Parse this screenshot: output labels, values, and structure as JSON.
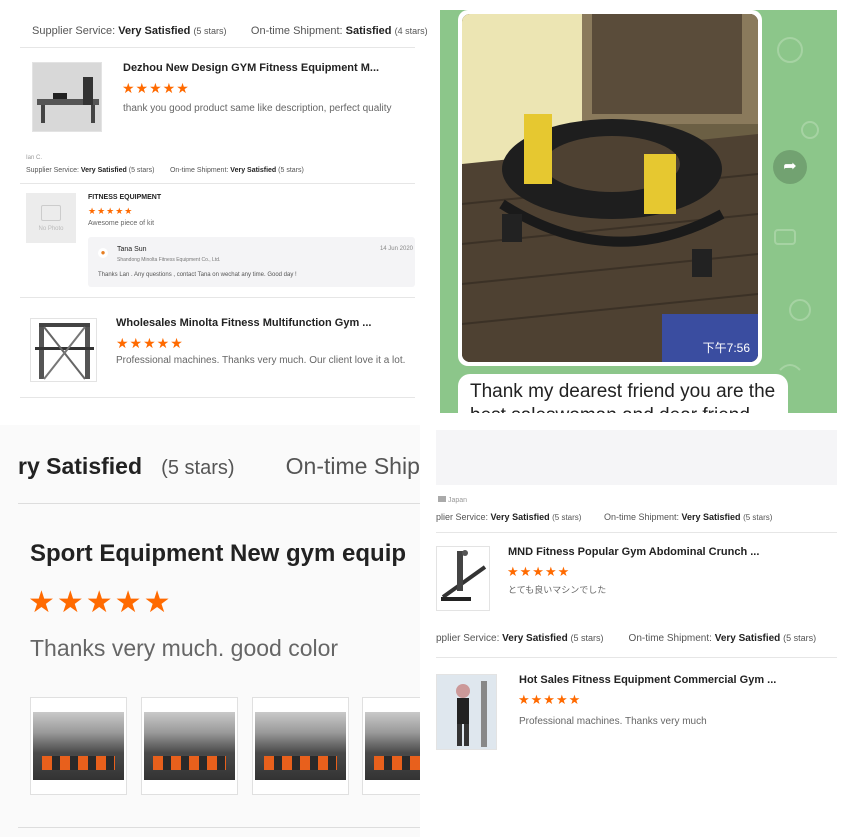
{
  "panel_a": {
    "ratings_row": {
      "supplier_label": "Supplier Service:",
      "supplier_value": "Very Satisfied",
      "supplier_stars": "(5 stars)",
      "shipment_label": "On-time Shipment:",
      "shipment_value": "Satisfied",
      "shipment_stars": "(4 stars)"
    },
    "review1": {
      "title": "Dezhou New Design GYM Fitness Equipment M...",
      "stars": "★★★★★",
      "comment": "thank you good product same like description,  perfect quality",
      "reviewer": "Ian C.",
      "ratings": {
        "supplier_label": "Supplier Service:",
        "supplier_value": "Very Satisfied",
        "supplier_stars": "(5 stars)",
        "shipment_label": "On-time Shipment:",
        "shipment_value": "Very Satisfied",
        "shipment_stars": "(5 stars)"
      }
    },
    "review2": {
      "thumb_text": "No Photo",
      "title": "FITNESS EQUIPMENT",
      "stars": "★★★★★",
      "comment": "Awesome piece of kit",
      "reply": {
        "name": "Tana Sun",
        "company": "Shandong Minolta Fitness Equipment Co., Ltd.",
        "date": "14 Jun 2020",
        "text": "Thanks Lan . Any questions , contact Tana on wechat any time. Good day !"
      }
    },
    "review3": {
      "title": "Wholesales Minolta Fitness Multifunction Gym ...",
      "stars": "★★★★★",
      "comment": "Professional machines. Thanks very much. Our client love it a lot."
    }
  },
  "panel_b": {
    "time": "下午7:56",
    "message": "Thank my dearest friend you are the best saleswoman and dear friend ❤️",
    "share_icon": "share-icon"
  },
  "panel_c": {
    "ratings_row": {
      "supplier_tail": "ry Satisfied",
      "supplier_stars": "(5 stars)",
      "shipment_label": "On-time Ship"
    },
    "title": "Sport Equipment New gym equip",
    "stars": "★★★★★",
    "comment": "Thanks very much.  good color"
  },
  "panel_d": {
    "country": "Japan",
    "ratings1": {
      "supplier_label": "plier Service:",
      "supplier_value": "Very Satisfied",
      "supplier_stars": "(5 stars)",
      "shipment_label": "On-time Shipment:",
      "shipment_value": "Very Satisfied",
      "shipment_stars": "(5 stars)"
    },
    "review1": {
      "title": "MND Fitness Popular Gym Abdominal Crunch ...",
      "stars": "★★★★★",
      "comment": "とても良いマシンでした"
    },
    "ratings2": {
      "supplier_label": "pplier Service:",
      "supplier_value": "Very Satisfied",
      "supplier_stars": "(5 stars)",
      "shipment_label": "On-time Shipment:",
      "shipment_value": "Very Satisfied",
      "shipment_stars": "(5 stars)"
    },
    "review2": {
      "title": "Hot Sales Fitness Equipment Commercial Gym ...",
      "stars": "★★★★★",
      "comment": "Professional machines. Thanks very much"
    }
  },
  "colors": {
    "star_orange": "#ff6a00",
    "chat_green": "#8cc68a"
  }
}
